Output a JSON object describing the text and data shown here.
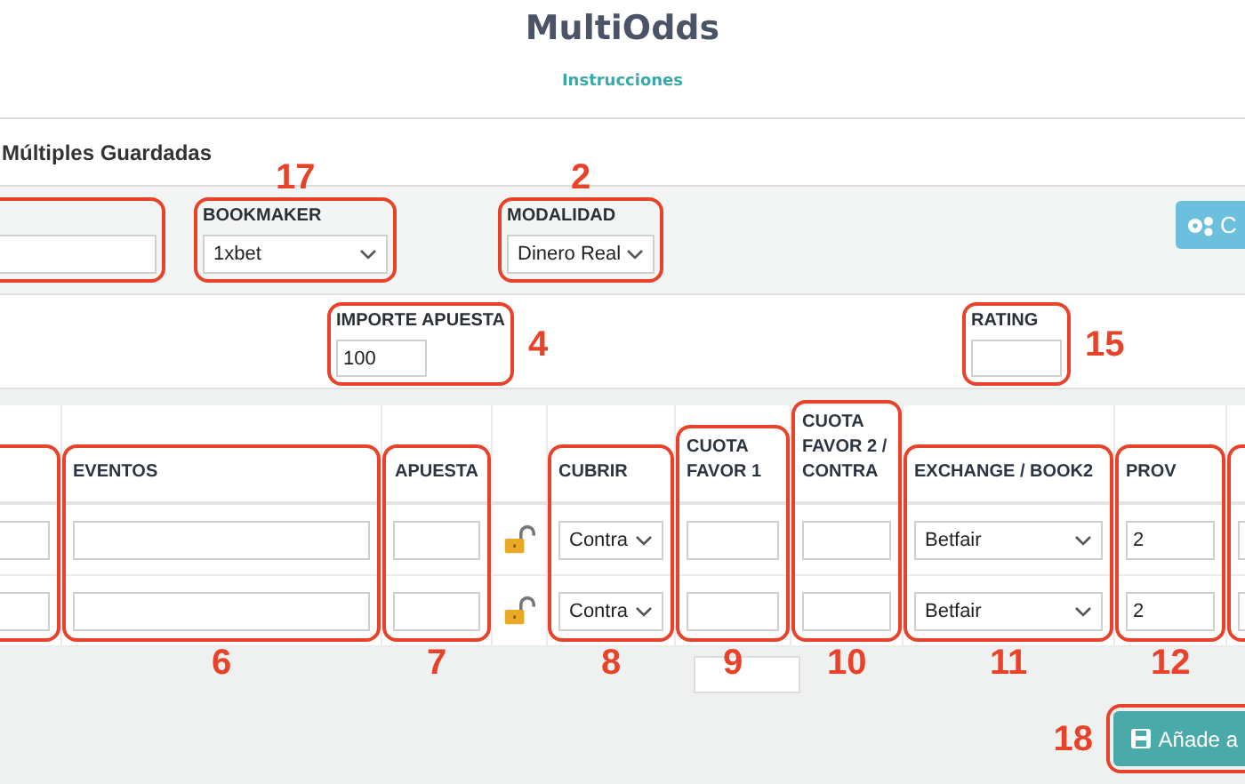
{
  "header": {
    "title": "MultiOdds",
    "link": "Instrucciones"
  },
  "section_title": "Múltiples Guardadas",
  "settings_row": {
    "fields": [
      {
        "kind": "input",
        "annotation": {
          "outlined": true
        }
      },
      {
        "kind": "select",
        "label": "BOOKMAKER",
        "value": "1xbet",
        "annotation": {
          "outlined": true,
          "number": "17"
        }
      },
      {
        "kind": "select",
        "label": "MODALIDAD",
        "value": "Dinero Real",
        "annotation": {
          "outlined": true,
          "number": "2"
        }
      }
    ],
    "button": {
      "label": "C"
    }
  },
  "stake_row": {
    "fields": [
      {
        "kind": "input",
        "label": "IMPORTE APUESTA",
        "value": "100",
        "annotation": {
          "outlined": true,
          "number": "4"
        }
      },
      {
        "kind": "input",
        "label": "RATING",
        "annotation": {
          "outlined": true,
          "number": "15"
        }
      }
    ]
  },
  "table": {
    "columns": [
      {
        "kind": "input",
        "annotation": {
          "outlined": true
        }
      },
      {
        "kind": "input",
        "header": "EVENTOS",
        "annotation": {
          "outlined": true,
          "number": "6"
        }
      },
      {
        "kind": "input",
        "header": "APUESTA",
        "annotation": {
          "outlined": true,
          "number": "7"
        }
      },
      {
        "kind": "lock"
      },
      {
        "kind": "select",
        "header": "CUBRIR",
        "annotation": {
          "outlined": true,
          "number": "8"
        }
      },
      {
        "kind": "input",
        "header": "CUOTA FAVOR 1",
        "annotation": {
          "outlined": true,
          "number": "9"
        }
      },
      {
        "kind": "input",
        "header": "CUOTA FAVOR 2 / CONTRA",
        "annotation": {
          "outlined": true,
          "number": "10"
        }
      },
      {
        "kind": "select",
        "header": "EXCHANGE / BOOK2",
        "annotation": {
          "outlined": true,
          "number": "11"
        }
      },
      {
        "kind": "input",
        "header": "PROV",
        "annotation": {
          "outlined": true,
          "number": "12"
        }
      },
      {
        "kind": "input",
        "annotation": {
          "outlined": true
        }
      }
    ],
    "rows": [
      {
        "cubrir": "Contra",
        "exchange": "Betfair",
        "prov": "2"
      },
      {
        "cubrir": "Contra",
        "exchange": "Betfair",
        "prov": "2"
      }
    ]
  },
  "footer": {
    "save_button": {
      "label": "Añade a",
      "annotation": {
        "outlined": true,
        "number": "18"
      }
    }
  }
}
